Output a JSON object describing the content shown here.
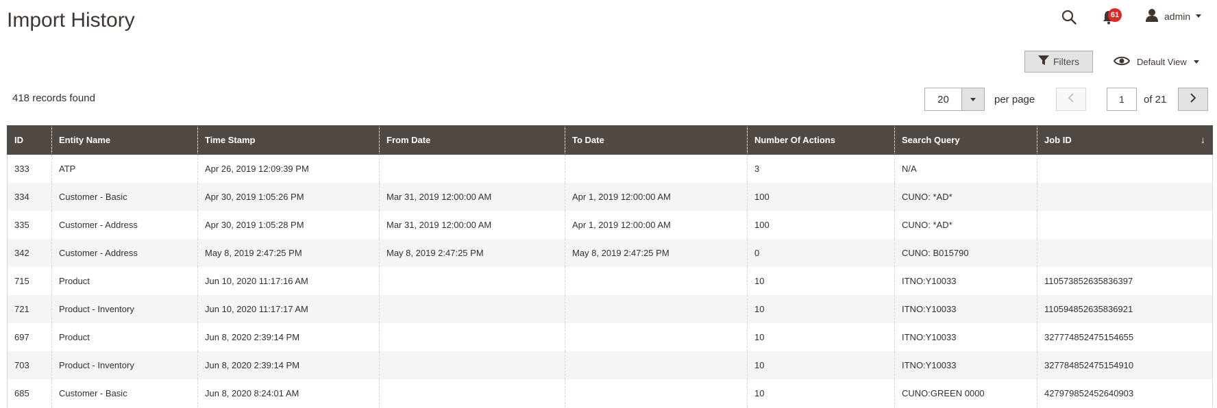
{
  "page": {
    "title": "Import History"
  },
  "header": {
    "notifications_count": "61",
    "user_name": "admin"
  },
  "toolbar": {
    "filters_label": "Filters",
    "view_label": "Default View",
    "records_found": "418 records found",
    "per_page_value": "20",
    "per_page_label": "per page",
    "current_page": "1",
    "total_pages": "of 21"
  },
  "colors": {
    "header_bg": "#514943",
    "badge": "#e22626",
    "alt_row": "#f5f5f5"
  },
  "icons": {
    "search": "search-icon",
    "bell": "bell-icon",
    "user": "user-icon",
    "filter": "filter-icon",
    "eye": "eye-icon",
    "prev": "chevron-left-icon",
    "next": "chevron-right-icon"
  },
  "table": {
    "columns": [
      "ID",
      "Entity Name",
      "Time Stamp",
      "From Date",
      "To Date",
      "Number Of Actions",
      "Search Query",
      "Job ID"
    ],
    "sort_indicator": "↓",
    "rows": [
      [
        "333",
        "ATP",
        "Apr 26, 2019 12:09:39 PM",
        "",
        "",
        "3",
        "N/A",
        ""
      ],
      [
        "334",
        "Customer - Basic",
        "Apr 30, 2019 1:05:26 PM",
        "Mar 31, 2019 12:00:00 AM",
        "Apr 1, 2019 12:00:00 AM",
        "100",
        "CUNO: *AD*",
        ""
      ],
      [
        "335",
        "Customer - Address",
        "Apr 30, 2019 1:05:28 PM",
        "Mar 31, 2019 12:00:00 AM",
        "Apr 1, 2019 12:00:00 AM",
        "100",
        "CUNO: *AD*",
        ""
      ],
      [
        "342",
        "Customer - Address",
        "May 8, 2019 2:47:25 PM",
        "May 8, 2019 2:47:25 PM",
        "May 8, 2019 2:47:25 PM",
        "0",
        "CUNO: B015790",
        ""
      ],
      [
        "715",
        "Product",
        "Jun 10, 2020 11:17:16 AM",
        "",
        "",
        "10",
        "ITNO:Y10033",
        "110573852635836397"
      ],
      [
        "721",
        "Product - Inventory",
        "Jun 10, 2020 11:17:17 AM",
        "",
        "",
        "10",
        "ITNO:Y10033",
        "110594852635836921"
      ],
      [
        "697",
        "Product",
        "Jun 8, 2020 2:39:14 PM",
        "",
        "",
        "10",
        "ITNO:Y10033",
        "327774852475154655"
      ],
      [
        "703",
        "Product - Inventory",
        "Jun 8, 2020 2:39:14 PM",
        "",
        "",
        "10",
        "ITNO:Y10033",
        "327784852475154910"
      ],
      [
        "685",
        "Customer - Basic",
        "Jun 8, 2020 8:24:01 AM",
        "",
        "",
        "10",
        "CUNO:GREEN 0000",
        "427979852452640903"
      ]
    ]
  }
}
